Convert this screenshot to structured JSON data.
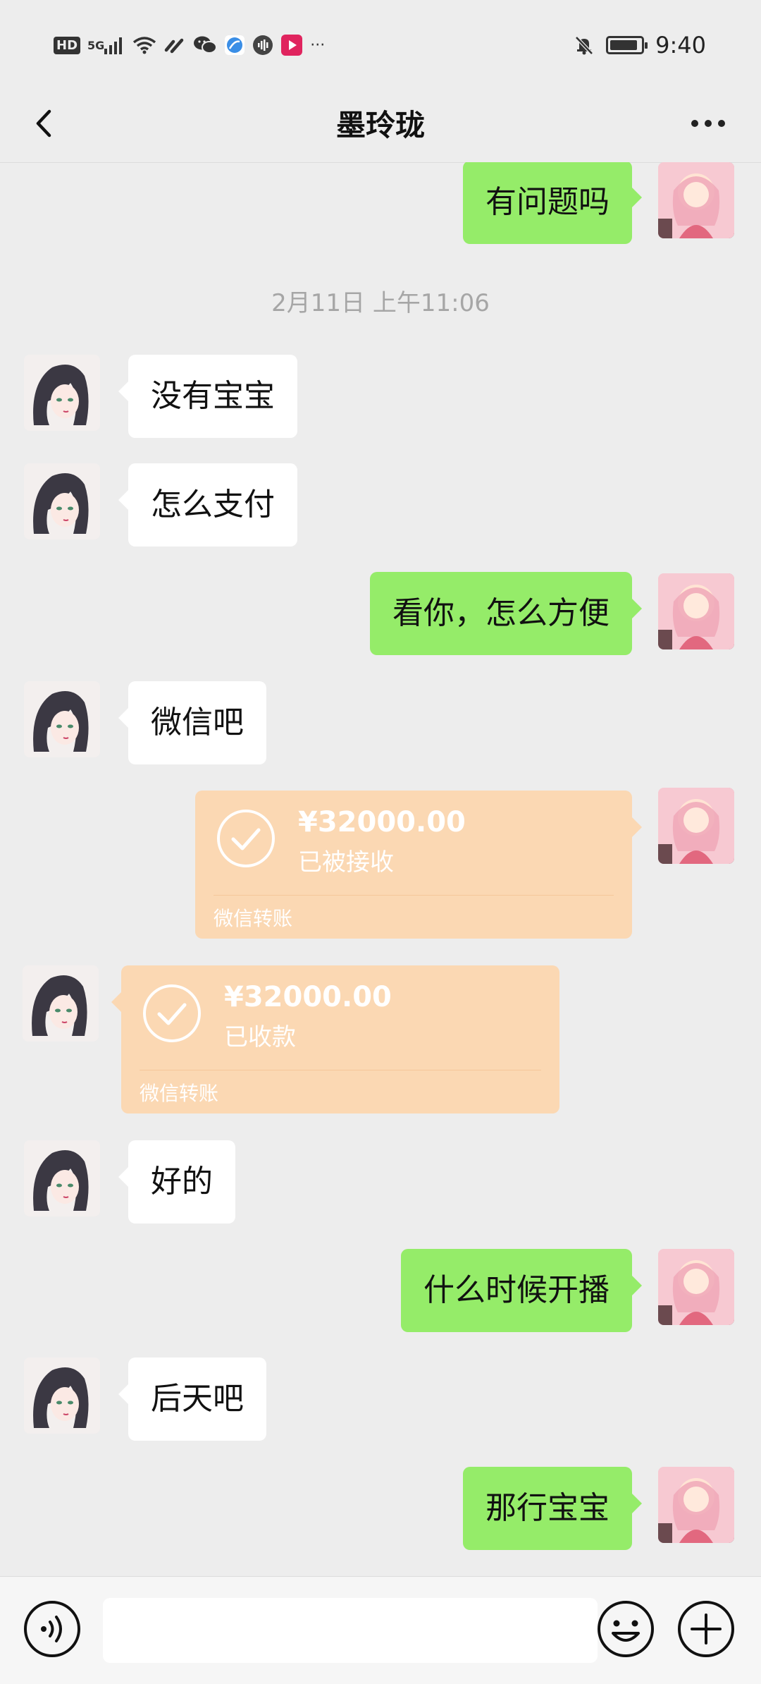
{
  "status_bar": {
    "hd": "HD",
    "network": "5G",
    "more": "···",
    "time": "9:40",
    "icons": [
      "hd-icon",
      "signal-icon",
      "wifi-icon",
      "link-icon",
      "wechat-icon",
      "browser-icon",
      "audio-icon",
      "video-icon",
      "more-dots-icon",
      "mute-bell-icon",
      "battery-icon"
    ]
  },
  "nav": {
    "title": "墨玲珑",
    "back_icon": "chevron-left-icon",
    "more_icon": "more-horizontal-icon"
  },
  "messages": [
    {
      "side": "right",
      "text": "有问题吗"
    },
    {
      "type": "time",
      "text": "2月11日 上午11:06"
    },
    {
      "side": "left",
      "text": "没有宝宝"
    },
    {
      "side": "left",
      "text": "怎么支付"
    },
    {
      "side": "right",
      "text": "看你，怎么方便"
    },
    {
      "side": "left",
      "text": "微信吧"
    },
    {
      "side": "right",
      "type": "transfer",
      "amount": "¥32000.00",
      "status": "已被接收",
      "label": "微信转账"
    },
    {
      "side": "left",
      "type": "transfer",
      "amount": "¥32000.00",
      "status": "已收款",
      "label": "微信转账"
    },
    {
      "side": "left",
      "text": "好的"
    },
    {
      "side": "right",
      "text": "什么时候开播"
    },
    {
      "side": "left",
      "text": "后天吧"
    },
    {
      "side": "right",
      "text": "那行宝宝"
    }
  ],
  "input_bar": {
    "voice_icon": "voice-icon",
    "emoji_icon": "emoji-icon",
    "plus_icon": "plus-icon",
    "placeholder": ""
  },
  "colors": {
    "background": "#ededed",
    "bubble_right": "#95ec69",
    "bubble_left": "#ffffff",
    "transfer": "#fbd8b3"
  }
}
